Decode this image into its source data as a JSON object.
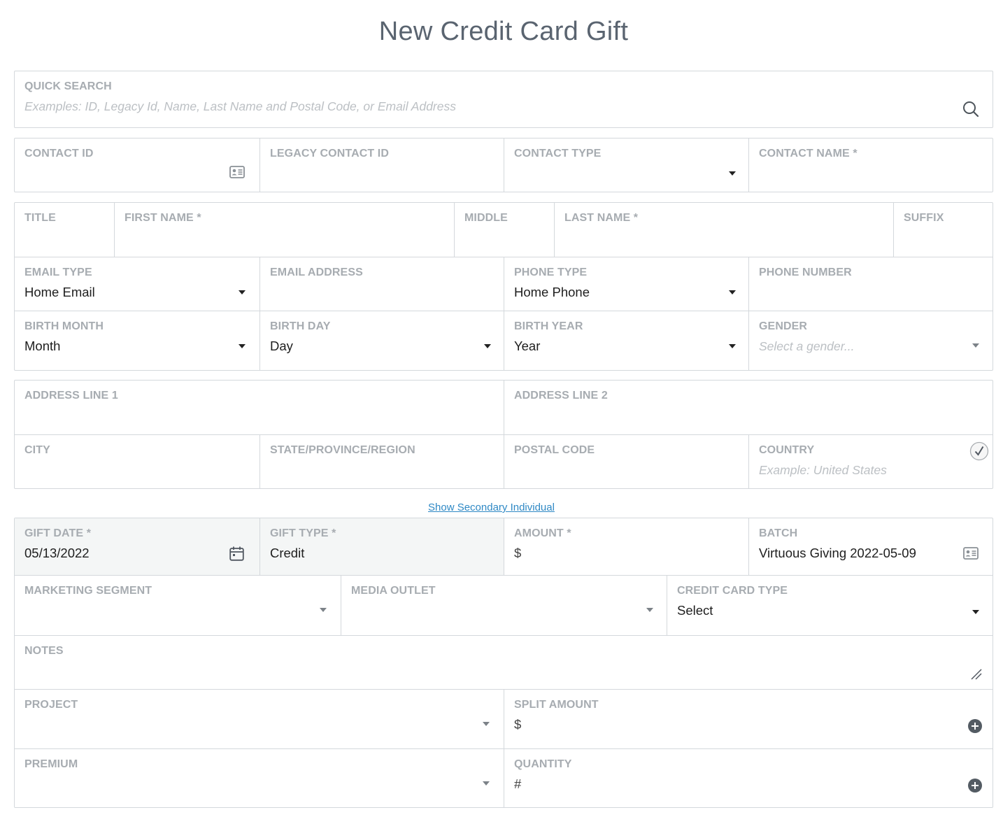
{
  "page": {
    "title": "New Credit Card Gift"
  },
  "quick_search": {
    "label": "QUICK SEARCH",
    "placeholder": "Examples: ID, Legacy Id, Name, Last Name and Postal Code, or Email Address",
    "icon": "search-icon"
  },
  "contact": {
    "contact_id": {
      "label": "CONTACT ID",
      "icon": "id-card-icon"
    },
    "legacy_contact_id": {
      "label": "LEGACY CONTACT ID"
    },
    "contact_type": {
      "label": "CONTACT TYPE"
    },
    "contact_name": {
      "label": "CONTACT NAME *"
    }
  },
  "name": {
    "title": {
      "label": "TITLE"
    },
    "first_name": {
      "label": "FIRST NAME *"
    },
    "middle": {
      "label": "MIDDLE"
    },
    "last_name": {
      "label": "LAST NAME *"
    },
    "suffix": {
      "label": "SUFFIX"
    }
  },
  "communication": {
    "email_type": {
      "label": "EMAIL TYPE",
      "value": "Home Email"
    },
    "email_address": {
      "label": "EMAIL ADDRESS"
    },
    "phone_type": {
      "label": "PHONE TYPE",
      "value": "Home Phone"
    },
    "phone_number": {
      "label": "PHONE NUMBER"
    }
  },
  "birth": {
    "month": {
      "label": "BIRTH MONTH",
      "value": "Month"
    },
    "day": {
      "label": "BIRTH DAY",
      "value": "Day"
    },
    "year": {
      "label": "BIRTH YEAR",
      "value": "Year"
    },
    "gender": {
      "label": "GENDER",
      "placeholder": "Select a gender..."
    }
  },
  "address": {
    "line1": {
      "label": "ADDRESS LINE 1"
    },
    "line2": {
      "label": "ADDRESS LINE 2"
    },
    "city": {
      "label": "CITY"
    },
    "state": {
      "label": "STATE/PROVINCE/REGION"
    },
    "postal_code": {
      "label": "POSTAL CODE"
    },
    "country": {
      "label": "COUNTRY",
      "placeholder": "Example: United States",
      "icon": "check-circle-icon"
    }
  },
  "secondary_link": "Show Secondary Individual",
  "gift": {
    "gift_date": {
      "label": "GIFT DATE *",
      "value": "05/13/2022",
      "icon": "calendar-icon"
    },
    "gift_type": {
      "label": "GIFT TYPE *",
      "value": "Credit"
    },
    "amount": {
      "label": "AMOUNT *",
      "prefix": "$"
    },
    "batch": {
      "label": "BATCH",
      "value": "Virtuous Giving 2022-05-09",
      "icon": "id-card-icon"
    },
    "marketing_segment": {
      "label": "MARKETING SEGMENT"
    },
    "media_outlet": {
      "label": "MEDIA OUTLET"
    },
    "credit_card_type": {
      "label": "CREDIT CARD TYPE",
      "value": "Select"
    },
    "notes": {
      "label": "NOTES"
    },
    "project": {
      "label": "PROJECT"
    },
    "split_amount": {
      "label": "SPLIT AMOUNT",
      "prefix": "$",
      "icon": "plus-circle-icon"
    },
    "premium": {
      "label": "PREMIUM"
    },
    "quantity": {
      "label": "QUANTITY",
      "prefix": "#",
      "icon": "plus-circle-icon"
    }
  }
}
